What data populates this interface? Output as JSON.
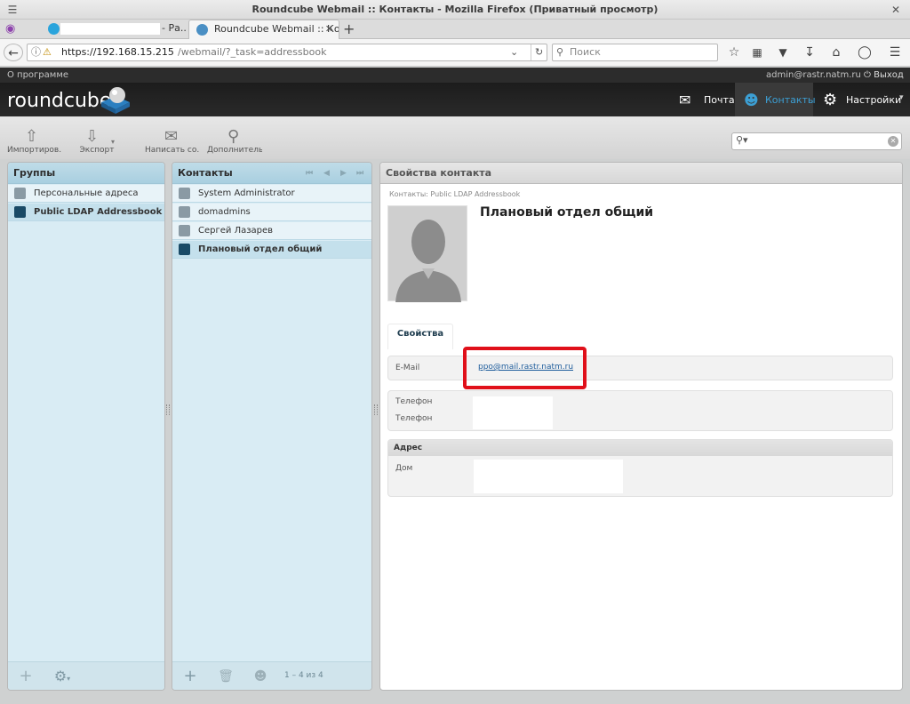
{
  "window": {
    "title": "Roundcube Webmail :: Контакты - Mozilla Firefox (Приватный просмотр)"
  },
  "tabs": [
    {
      "label": "- Ра...",
      "active": false
    },
    {
      "label": "Roundcube Webmail :: Ко...",
      "active": true
    }
  ],
  "nav": {
    "url_host": "https://192.168.15.215",
    "url_path": "/webmail/?_task=addressbook",
    "search_placeholder": "Поиск"
  },
  "topline": {
    "about_label": "О программе",
    "username": "admin@rastr.natm.ru",
    "logout_label": "Выход"
  },
  "header": {
    "logo_text": "roundcube",
    "tasks": [
      {
        "label": "Почта",
        "icon": "envelope-icon",
        "selected": false
      },
      {
        "label": "Контакты",
        "icon": "person-icon",
        "selected": true
      },
      {
        "label": "Настройки",
        "icon": "gear-icon",
        "selected": false
      }
    ]
  },
  "toolbar": {
    "import_label": "Импортиров...",
    "export_label": "Экспорт",
    "compose_label": "Написать со...",
    "more_label": "Дополнитель..."
  },
  "groups": {
    "title": "Группы",
    "items": [
      {
        "label": "Персональные адреса",
        "selected": false
      },
      {
        "label": "Public LDAP Addressbook",
        "selected": true
      }
    ]
  },
  "contacts": {
    "title": "Контакты",
    "items": [
      {
        "label": "System Administrator",
        "selected": false
      },
      {
        "label": "domadmins",
        "selected": false
      },
      {
        "label": "Сергей Лазарев",
        "selected": false
      },
      {
        "label": "Плановый отдел общий",
        "selected": true
      }
    ],
    "count_label": "1 – 4 из 4"
  },
  "contact_view": {
    "title": "Свойства контакта",
    "source_label": "Контакты: Public LDAP Addressbook",
    "name": "Плановый отдел общий",
    "tab_label": "Свойства",
    "email_label": "E-Mail",
    "email_value": "ppo@mail.rastr.natm.ru",
    "phone1_label": "Телефон",
    "phone2_label": "Телефон",
    "address_heading": "Адрес",
    "address_label": "Дом"
  },
  "colors": {
    "accent": "#3c9fd4",
    "panel_blue": "#d9ecf4",
    "highlight_red": "#e0101a"
  }
}
